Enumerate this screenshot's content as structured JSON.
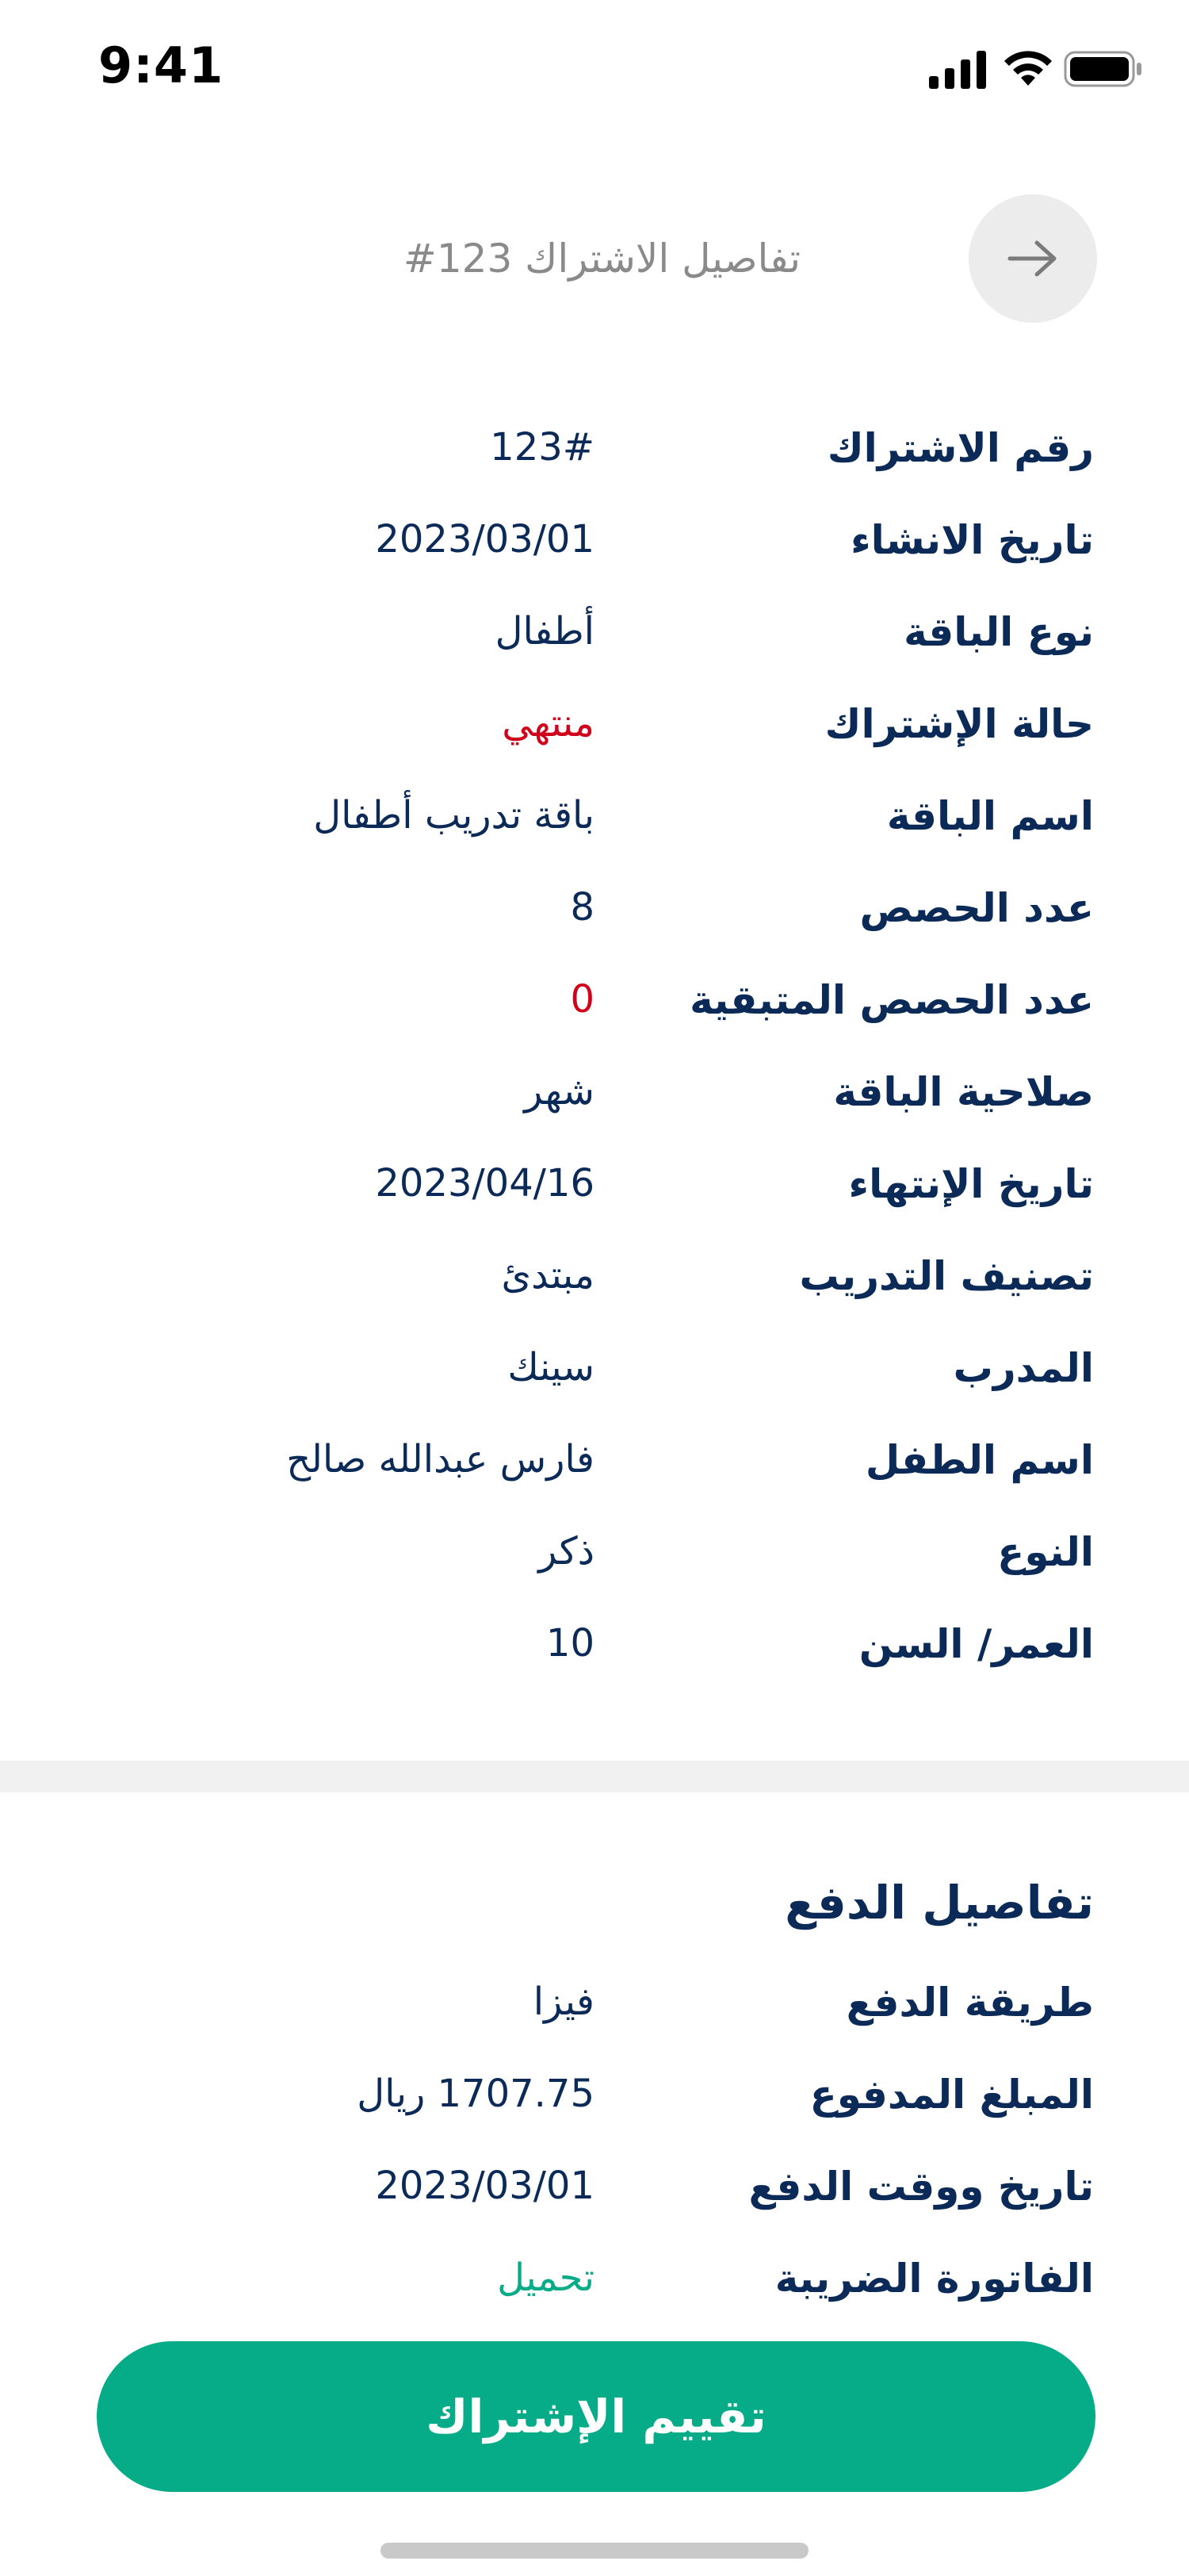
{
  "status_bar": {
    "time": "9:41"
  },
  "header": {
    "title": "تفاصيل الاشتراك 123#"
  },
  "details": [
    {
      "label": "رقم الاشتراك",
      "value": "123#",
      "value_color": "#0b2a57"
    },
    {
      "label": "تاريخ الانشاء",
      "value": "2023/03/01",
      "value_color": "#0b2a57"
    },
    {
      "label": "نوع الباقة",
      "value": "أطفال",
      "value_color": "#0b2a57"
    },
    {
      "label": "حالة الإشتراك",
      "value": "منتهي",
      "value_color": "#d0021b"
    },
    {
      "label": "اسم الباقة",
      "value": "باقة تدريب أطفال",
      "value_color": "#0b2a57"
    },
    {
      "label": "عدد الحصص",
      "value": "8",
      "value_color": "#0b2a57"
    },
    {
      "label": "عدد الحصص المتبقية",
      "value": "0",
      "value_color": "#d0021b"
    },
    {
      "label": "صلاحية الباقة",
      "value": "شهر",
      "value_color": "#0b2a57"
    },
    {
      "label": "تاريخ الإنتهاء",
      "value": "2023/04/16",
      "value_color": "#0b2a57"
    },
    {
      "label": "تصنيف التدريب",
      "value": "مبتدئ",
      "value_color": "#0b2a57"
    },
    {
      "label": "المدرب",
      "value": "سينك",
      "value_color": "#0b2a57"
    },
    {
      "label": "اسم الطفل",
      "value": "فارس عبدالله صالح",
      "value_color": "#0b2a57"
    },
    {
      "label": "النوع",
      "value": "ذكر",
      "value_color": "#0b2a57"
    },
    {
      "label": "العمر/ السن",
      "value": "10",
      "value_color": "#0b2a57"
    }
  ],
  "payment": {
    "title": "تفاصيل الدفع",
    "rows": [
      {
        "label": "طريقة الدفع",
        "value": "فيزا",
        "value_color": "#0b2a57"
      },
      {
        "label": "المبلغ المدفوع",
        "value": "1707.75 ريال",
        "value_color": "#0b2a57"
      },
      {
        "label": "تاريخ ووقت الدفع",
        "value": "2023/03/01",
        "value_color": "#0b2a57"
      },
      {
        "label": "الفاتورة الضريبة",
        "value": "تحميل",
        "value_color": "#06ab87"
      }
    ]
  },
  "cta": {
    "label": "تقييم الإشتراك",
    "color": "#06ab87"
  },
  "colors": {
    "primary_text": "#0b2a57",
    "danger": "#d0021b",
    "accent": "#06ab87"
  }
}
